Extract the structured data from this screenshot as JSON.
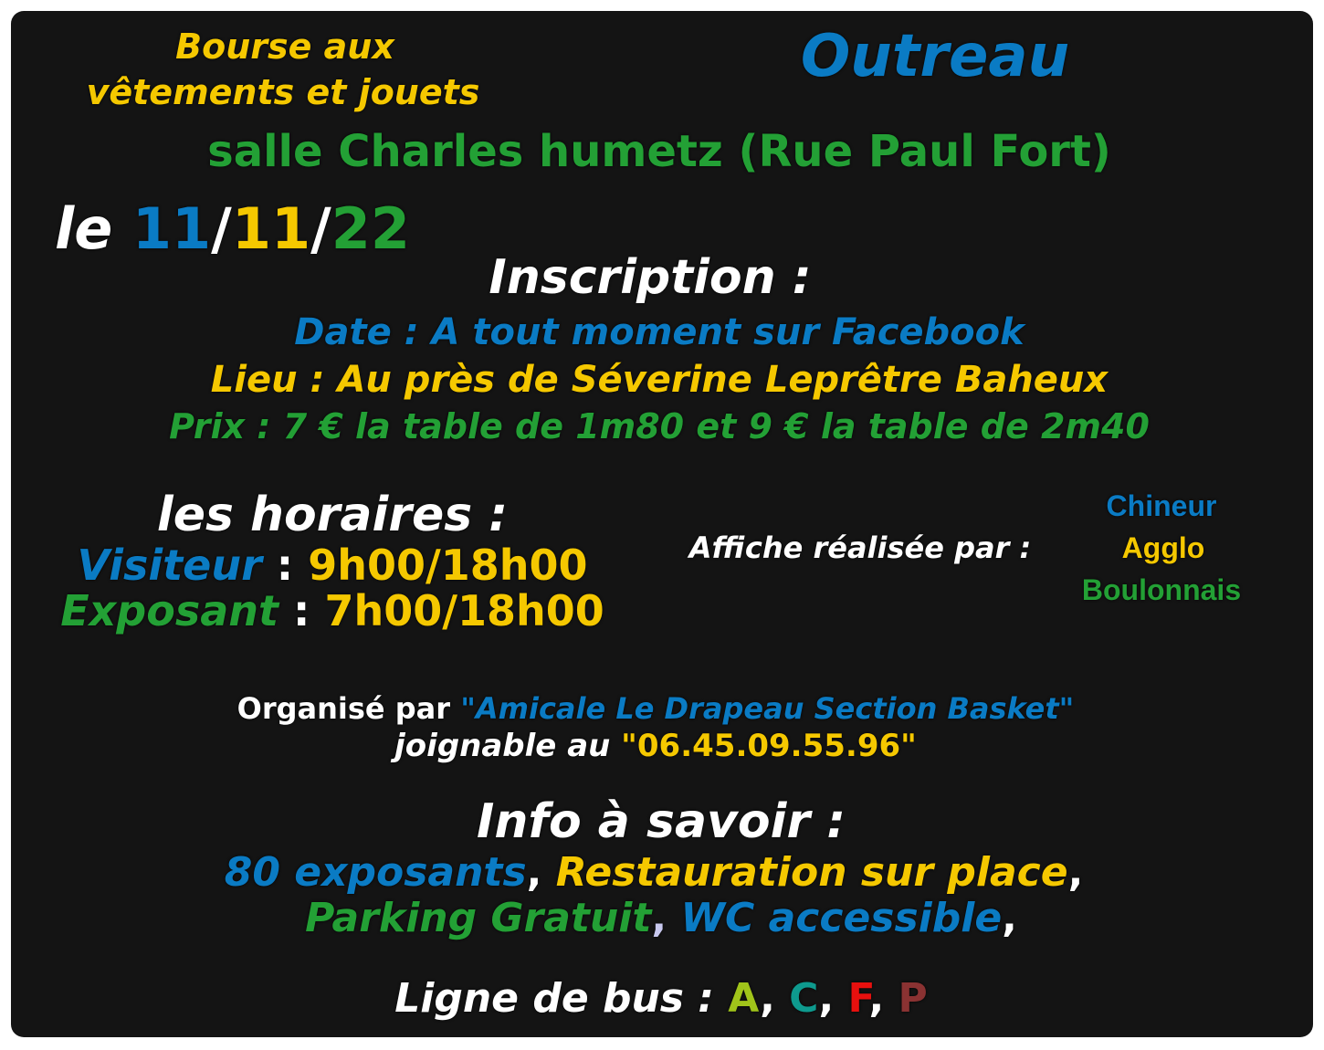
{
  "title": {
    "line1": "Bourse aux",
    "line2": "vêtements et jouets",
    "town": "Outreau",
    "venue": "salle Charles humetz (Rue Paul Fort)"
  },
  "date": {
    "prefix": "le ",
    "day": "11",
    "sep1": "/",
    "month": "11",
    "sep2": "/",
    "year": "22"
  },
  "inscription": {
    "heading": "Inscription :",
    "date_line": "Date : A tout moment sur Facebook",
    "lieu_line": "Lieu : Au près de Séverine Leprêtre Baheux",
    "prix_line": "Prix : 7 € la table de 1m80 et 9 € la table de 2m40"
  },
  "horaires": {
    "heading": "les horaires :",
    "visiteur_label": "Visiteur",
    "visiteur_sep": " : ",
    "visiteur_time": "9h00/18h00",
    "exposant_label": "Exposant",
    "exposant_sep": " : ",
    "exposant_time": "7h00/18h00"
  },
  "credit": {
    "label": "Affiche réalisée par :",
    "line1": "Chineur",
    "line2": "Agglo",
    "line3": "Boulonnais"
  },
  "organizer": {
    "prefix": "Organisé par ",
    "name": "\"Amicale Le Drapeau Section Basket\"",
    "phone_prefix": "joignable au ",
    "phone": "\"06.45.09.55.96\""
  },
  "info": {
    "heading": "Info à savoir :",
    "item1": "80 exposants",
    "comma1": ", ",
    "item2": "Restauration sur place",
    "comma2": ",",
    "item3": "Parking Gratuit",
    "comma3": ", ",
    "item4": "WC accessible",
    "comma4": ","
  },
  "bus": {
    "label": "Ligne de bus : ",
    "line_a": "A",
    "sep1": ", ",
    "line_c": "C",
    "sep2": ", ",
    "line_f": "F",
    "sep3": ", ",
    "line_p": "P"
  },
  "colors": {
    "background": "#141414",
    "blue": "#0a7bc4",
    "yellow": "#f5c800",
    "green": "#23a035",
    "white": "#ffffff",
    "bus_a": "#a0c41a",
    "bus_c": "#0e9a8e",
    "bus_f": "#e8100e",
    "bus_p": "#8a3232"
  }
}
